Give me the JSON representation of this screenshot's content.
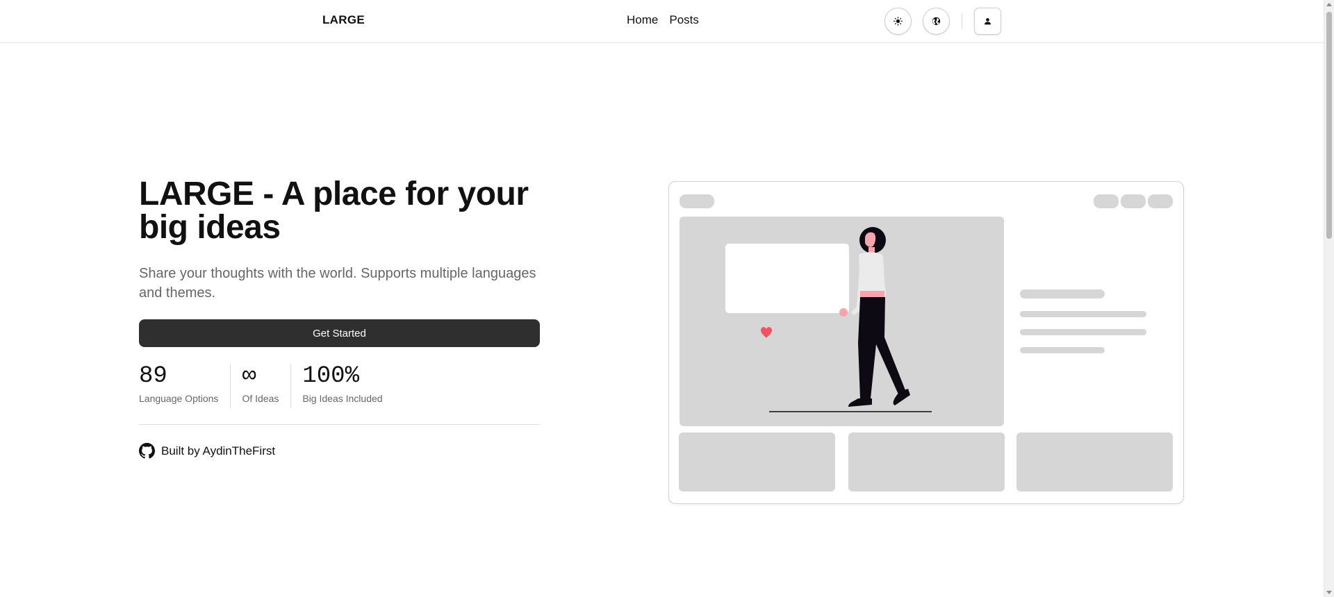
{
  "header": {
    "brand": "LARGE",
    "nav": [
      {
        "label": "Home"
      },
      {
        "label": "Posts"
      }
    ],
    "icons": {
      "theme_toggle": "sun-icon",
      "language": "globe-icon",
      "account": "user-icon"
    }
  },
  "hero": {
    "title": "LARGE - A place for your big ideas",
    "subtitle": "Share your thoughts with the world. Supports multiple languages and themes.",
    "cta_label": "Get Started",
    "stats": [
      {
        "value": "89",
        "label": "Language Options"
      },
      {
        "value": "∞",
        "label": "Of Ideas"
      },
      {
        "value": "100%",
        "label": "Big Ideas Included"
      }
    ],
    "built_by": "Built by AydinTheFirst",
    "built_by_icon": "github-icon"
  },
  "colors": {
    "primary_button": "#2f2f2f",
    "placeholder_gray": "#d6d6d6",
    "accent_red": "#f0535f",
    "skin": "#f6a4ad",
    "figure_dark": "#0d0a13"
  }
}
